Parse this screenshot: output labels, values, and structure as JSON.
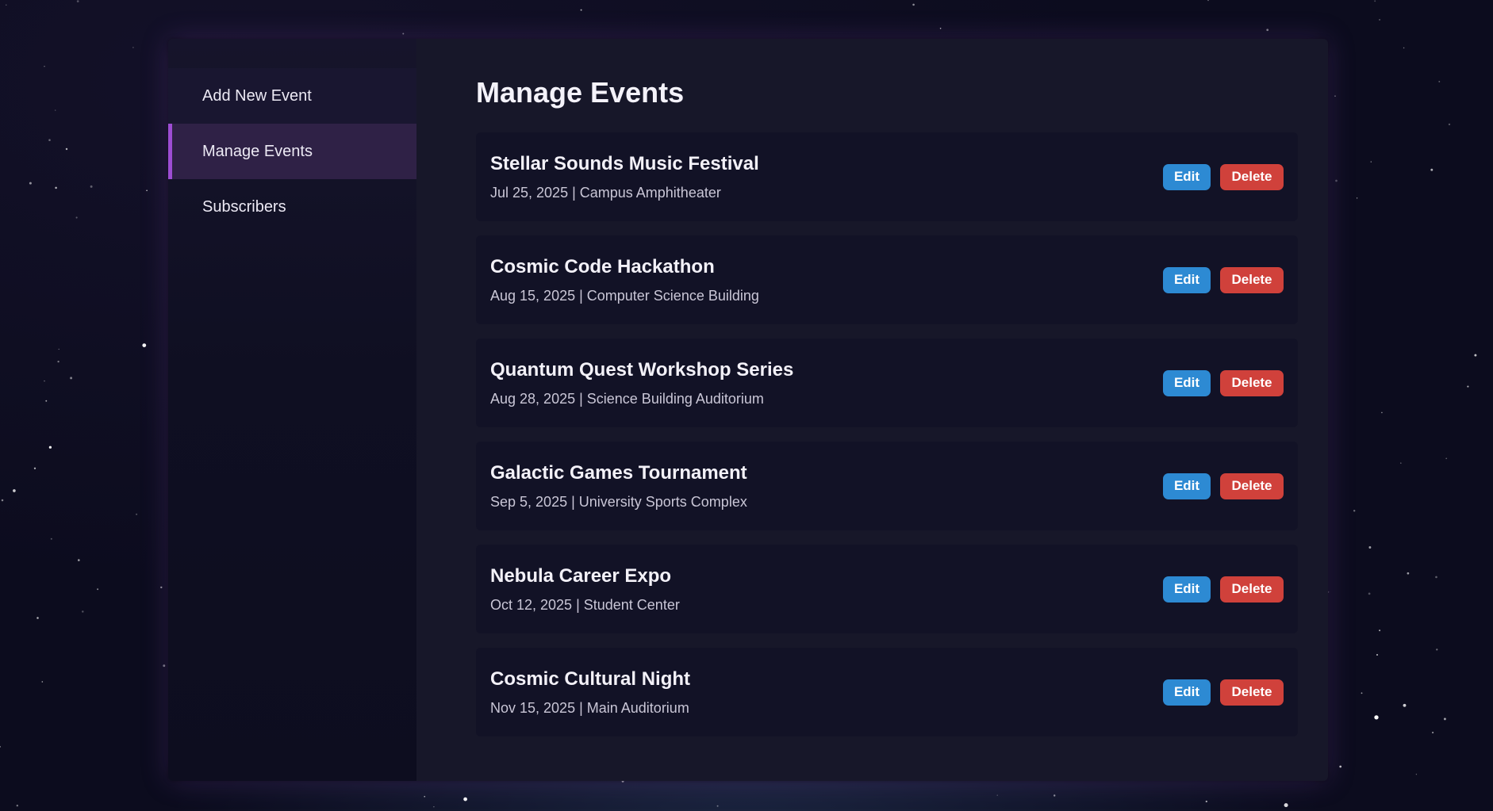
{
  "sidebar": {
    "items": [
      {
        "label": "Add New Event"
      },
      {
        "label": "Manage Events"
      },
      {
        "label": "Subscribers"
      }
    ]
  },
  "main": {
    "title": "Manage Events",
    "events": [
      {
        "title": "Stellar Sounds Music Festival",
        "meta": "Jul 25, 2025 | Campus Amphitheater",
        "edit_label": "Edit",
        "delete_label": "Delete"
      },
      {
        "title": "Cosmic Code Hackathon",
        "meta": "Aug 15, 2025 | Computer Science Building",
        "edit_label": "Edit",
        "delete_label": "Delete"
      },
      {
        "title": "Quantum Quest Workshop Series",
        "meta": "Aug 28, 2025 | Science Building Auditorium",
        "edit_label": "Edit",
        "delete_label": "Delete"
      },
      {
        "title": "Galactic Games Tournament",
        "meta": "Sep 5, 2025 | University Sports Complex",
        "edit_label": "Edit",
        "delete_label": "Delete"
      },
      {
        "title": "Nebula Career Expo",
        "meta": "Oct 12, 2025 | Student Center",
        "edit_label": "Edit",
        "delete_label": "Delete"
      },
      {
        "title": "Cosmic Cultural Night",
        "meta": "Nov 15, 2025 | Main Auditorium",
        "edit_label": "Edit",
        "delete_label": "Delete"
      }
    ]
  },
  "colors": {
    "background": "#0c0c1e",
    "sidebar_active_accent": "#9d4dd3",
    "edit_button": "#2d8ad3",
    "delete_button": "#d0413b"
  }
}
